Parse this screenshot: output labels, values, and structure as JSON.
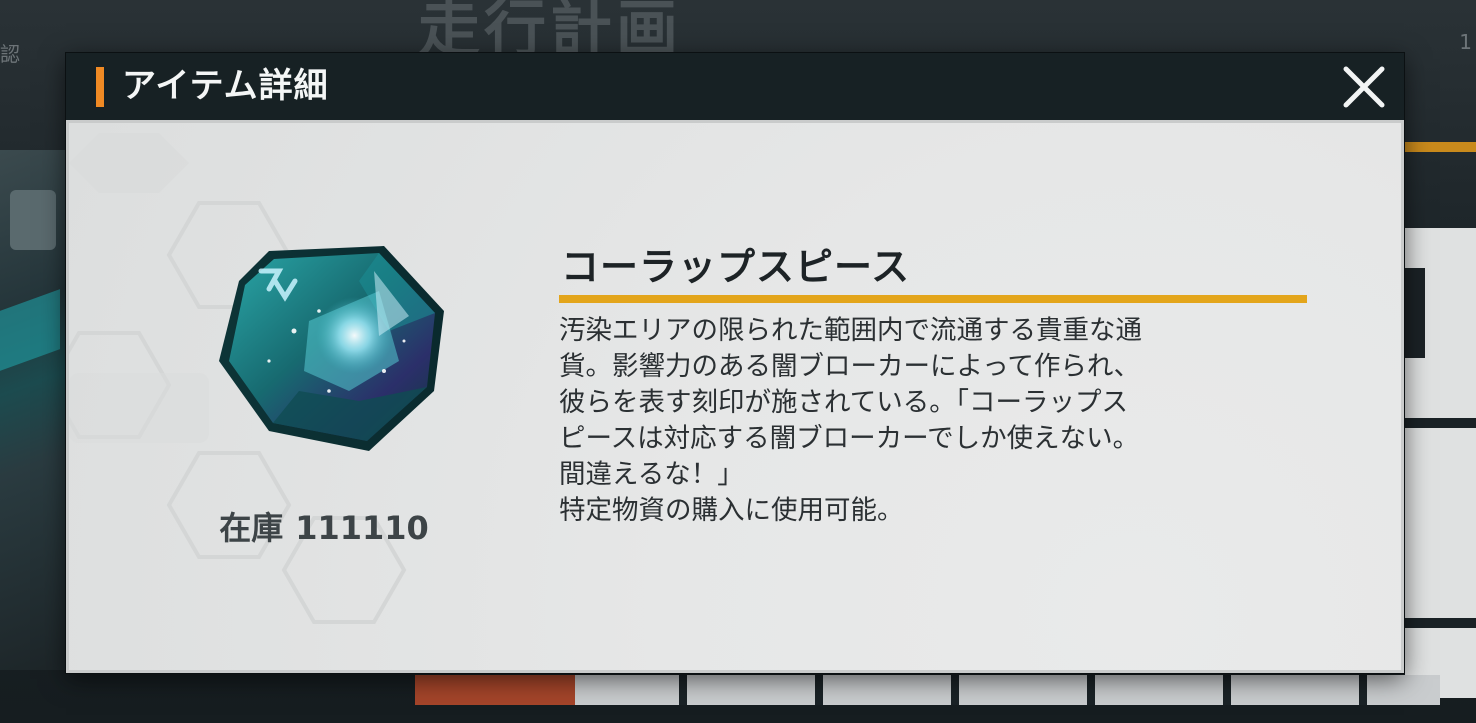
{
  "background": {
    "screen_title": "走行計画",
    "corner_left": "認",
    "corner_right": "1"
  },
  "dialog": {
    "title": "アイテム詳細",
    "close_icon": "close-icon",
    "accent_color": "#f08a24"
  },
  "item": {
    "icon": "corrupt-piece-gem-icon",
    "name": "コーラップスピース",
    "stock_label": "在庫",
    "stock_value": "111110",
    "underline_color": "#e3a51b",
    "description_lines": [
      "汚染エリアの限られた範囲内で流通する貴重な通",
      "貨。影響力のある闇ブローカーによって作られ、",
      "彼らを表す刻印が施されている。「コーラップス",
      "ピースは対応する闇ブローカーでしか使えない。",
      "間違えるな！」",
      "特定物資の購入に使用可能。"
    ]
  }
}
